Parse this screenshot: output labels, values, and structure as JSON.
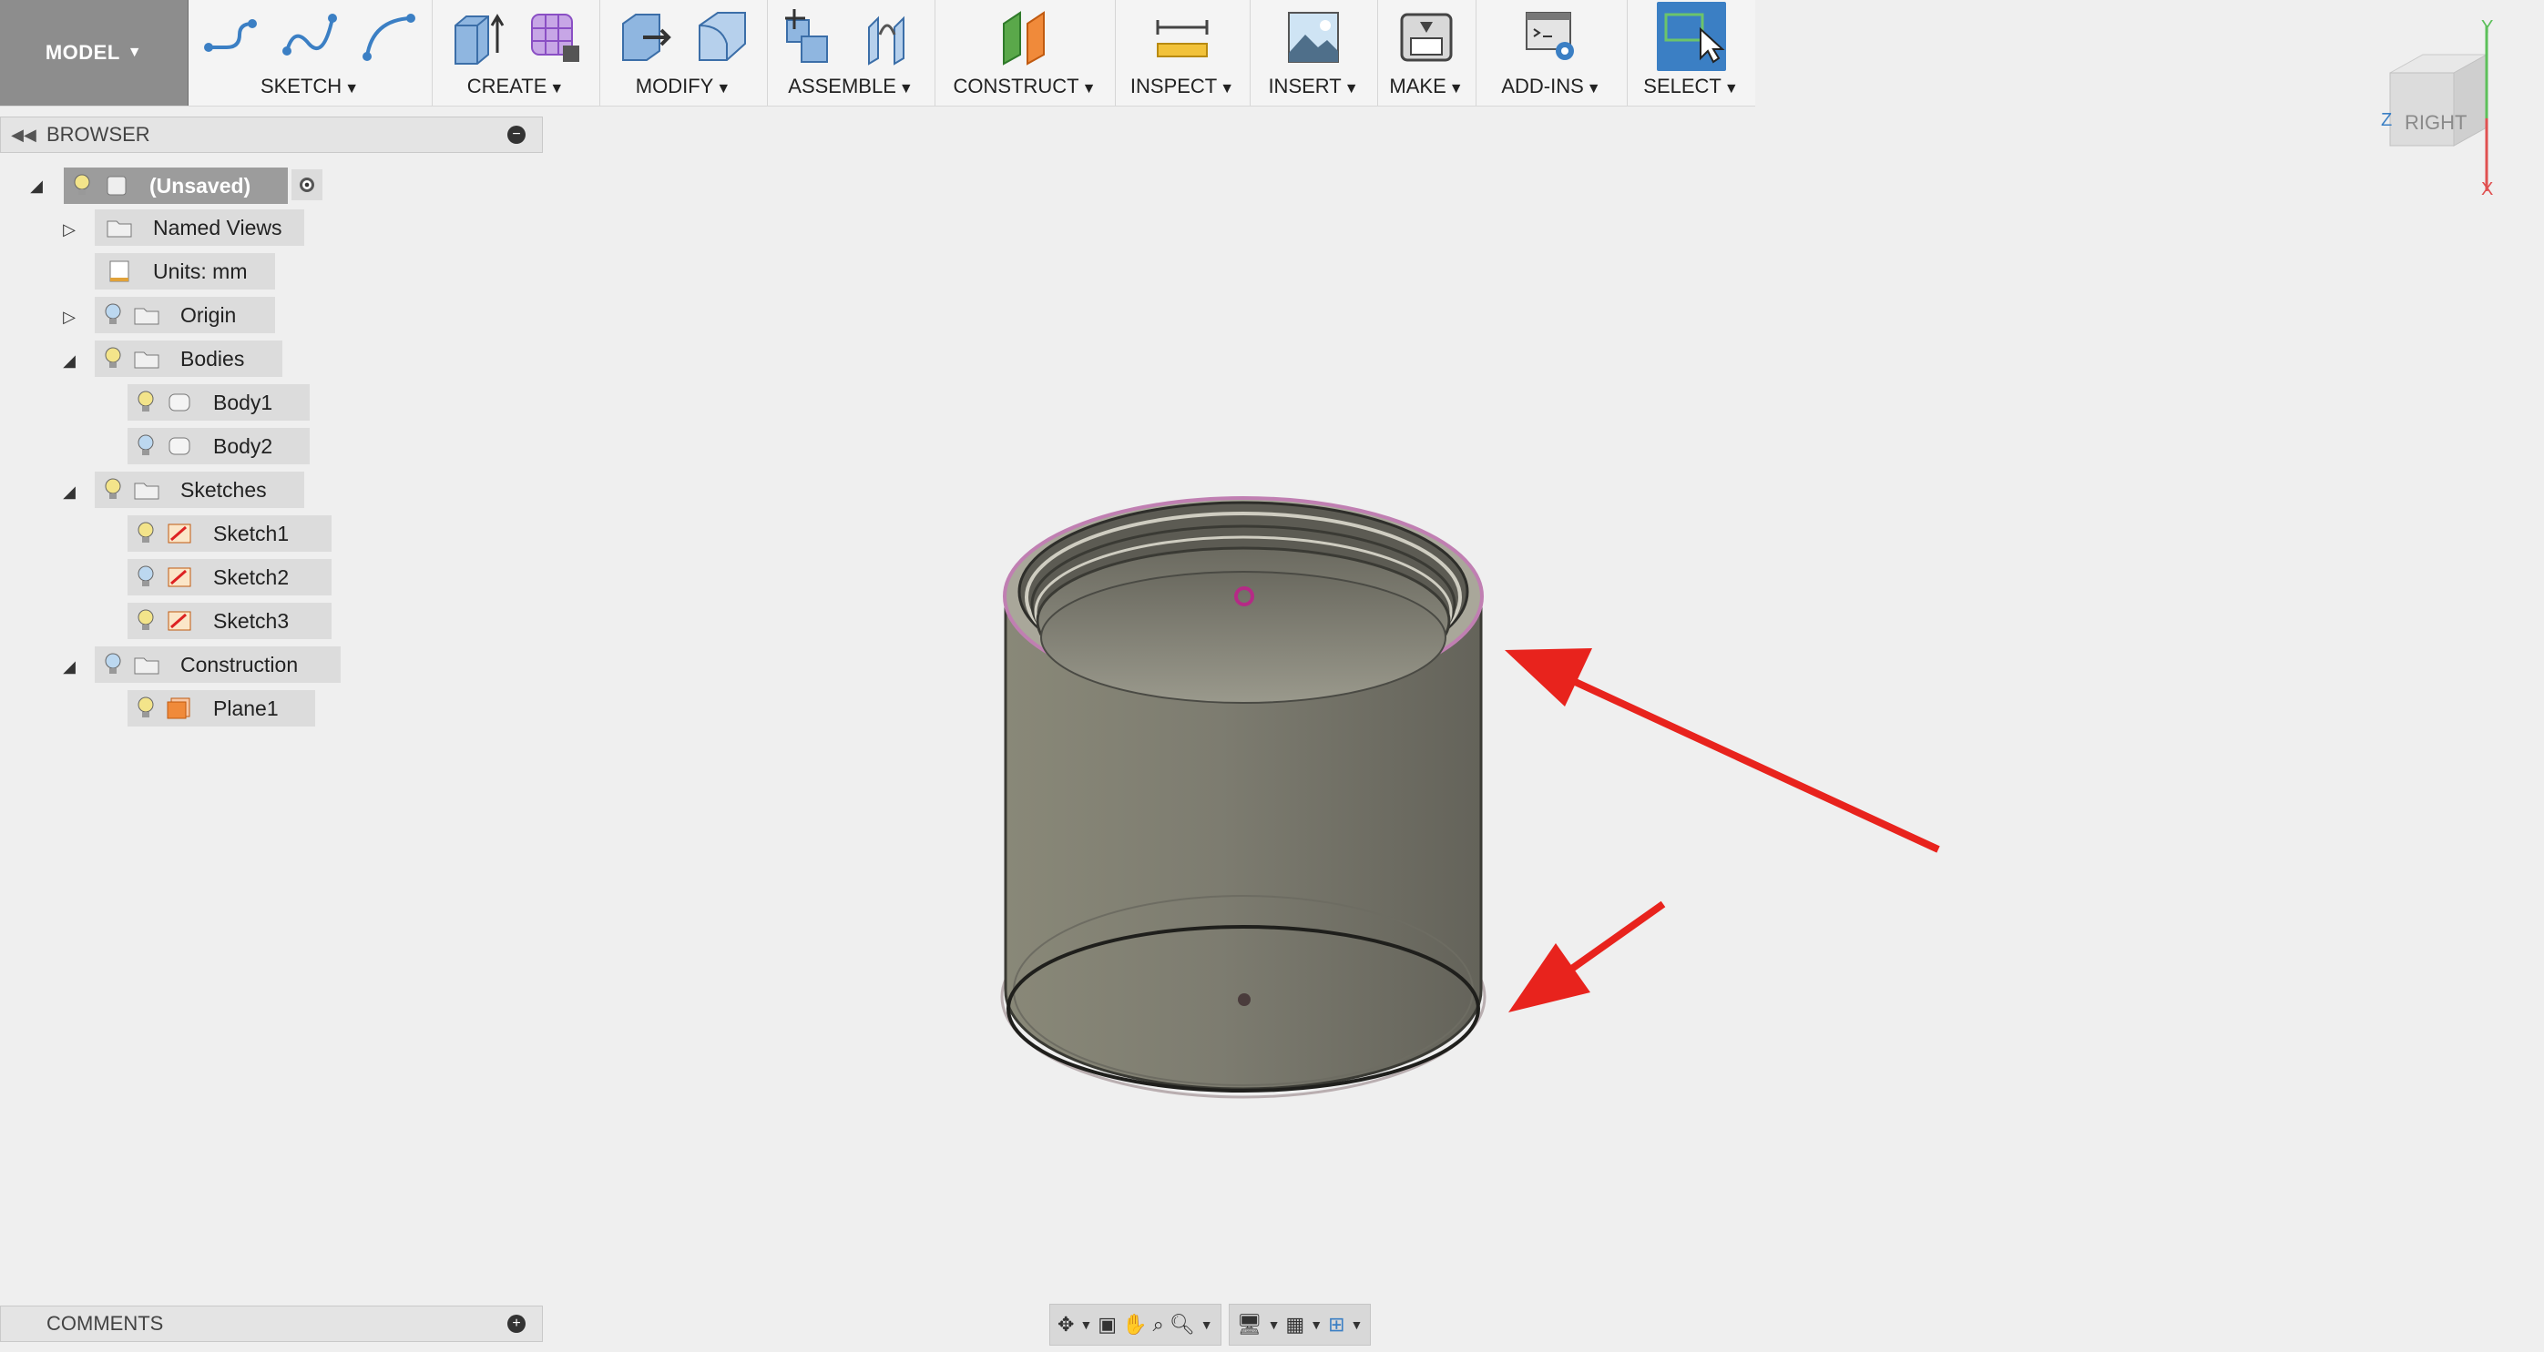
{
  "toolbar": {
    "workspace": "MODEL",
    "groups": [
      {
        "label": "SKETCH"
      },
      {
        "label": "CREATE"
      },
      {
        "label": "MODIFY"
      },
      {
        "label": "ASSEMBLE"
      },
      {
        "label": "CONSTRUCT"
      },
      {
        "label": "INSPECT"
      },
      {
        "label": "INSERT"
      },
      {
        "label": "MAKE"
      },
      {
        "label": "ADD-INS"
      },
      {
        "label": "SELECT"
      }
    ]
  },
  "browser": {
    "title": "BROWSER",
    "root": "(Unsaved)",
    "items": [
      {
        "label": "Named Views"
      },
      {
        "label": "Units: mm"
      },
      {
        "label": "Origin"
      },
      {
        "label": "Bodies"
      },
      {
        "label": "Body1"
      },
      {
        "label": "Body2"
      },
      {
        "label": "Sketches"
      },
      {
        "label": "Sketch1"
      },
      {
        "label": "Sketch2"
      },
      {
        "label": "Sketch3"
      },
      {
        "label": "Construction"
      },
      {
        "label": "Plane1"
      }
    ]
  },
  "comments": {
    "title": "COMMENTS"
  },
  "viewcube": {
    "face": "RIGHT",
    "axis_y": "Y",
    "axis_z": "Z",
    "axis_x": "X"
  },
  "colors": {
    "accent": "#3b7fc4",
    "arrow": "#e8231d",
    "body": "#7b7a6f"
  }
}
